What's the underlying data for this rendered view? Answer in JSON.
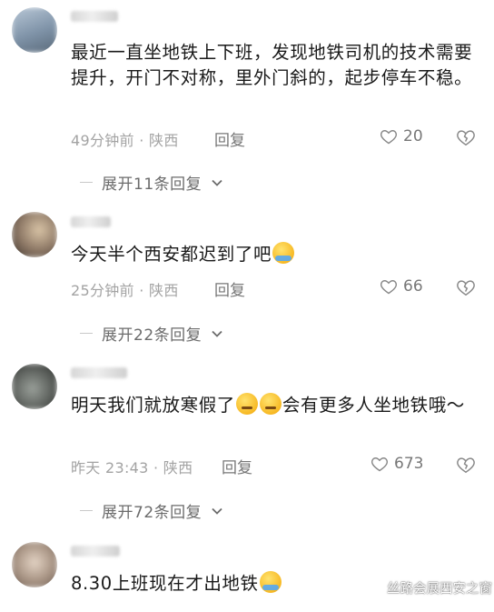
{
  "comments": [
    {
      "text": "最近一直坐地铁上下班，发现地铁司机的技术需要提升，开门不对称，里外门斜的，起步停车不稳。",
      "time": "49分钟前",
      "location": "陕西",
      "likes": "20",
      "expand": "展开11条回复"
    },
    {
      "text": "今天半个西安都迟到了吧",
      "time": "25分钟前",
      "location": "陕西",
      "likes": "66",
      "expand": "展开22条回复"
    },
    {
      "text_a": "明天我们就放寒假了",
      "text_b": "会有更多人坐地铁哦～",
      "time": "昨天 23:43",
      "location": "陕西",
      "likes": "673",
      "expand": "展开72条回复"
    },
    {
      "text": "8.30上班现在才出地铁"
    }
  ],
  "labels": {
    "reply": "回复",
    "sep": "·"
  },
  "watermark": "丝路会展西安之窗",
  "icons": [
    "heart-icon",
    "dislike-icon",
    "chevron-down-icon",
    "emoji-cry-laugh",
    "emoji-smirk",
    "emoji-loudly-crying",
    "wechat-watermark-icon"
  ]
}
